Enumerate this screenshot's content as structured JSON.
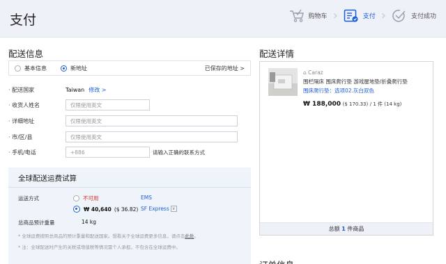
{
  "header": {
    "title": "支付",
    "steps": [
      {
        "label": "购物车",
        "icon": "cart-icon"
      },
      {
        "label": "支付",
        "icon": "checklist-icon"
      },
      {
        "label": "支付成功",
        "icon": "check-circle-icon"
      }
    ],
    "active_step": 1
  },
  "shipping": {
    "title": "配送信息",
    "tabs": [
      {
        "label": "基本信息",
        "selected": false
      },
      {
        "label": "新地址",
        "selected": true
      }
    ],
    "saved_addresses": "已保存的地址 >",
    "fields": {
      "country_label": "配送国家",
      "country_value": "Taiwan",
      "country_edit": "修改 >",
      "name_label": "收货人姓名",
      "name_placeholder": "仅限使用英文",
      "address_label": "详细地址",
      "address_placeholder": "仅限使用英文",
      "city_label": "市/区/县",
      "city_placeholder": "仅限使用英文",
      "phone_label": "手机/电话",
      "phone_prefix": "+886",
      "phone_hint": "请输入正确的联系方式"
    }
  },
  "shipping_calc": {
    "title": "全球配送运费试算",
    "method_label": "运送方式",
    "options": [
      {
        "price": "不可用",
        "carrier": "EMS",
        "selected": false
      },
      {
        "price": "₩ 40,640",
        "usd": "($ 36.82)",
        "carrier": "SF Express",
        "selected": true
      }
    ],
    "weight_label": "总商品预计重量",
    "weight_value": "14 kg",
    "note1": "* 全球运费按照总商品的预计重量和配送国家。想看关于全球运费更多信息，请点击",
    "note1_link": "此处",
    "note1_end": "。",
    "note2": "* 注：全球配送时产生的关税或增值税等情况需个人承担，不包含在全球运费中。"
  },
  "detail": {
    "title": "配送详情",
    "brand": "Caraz",
    "name": "围栏隔床 围床爬行垫 游戏屋地垫/折叠爬行垫",
    "option": "围床爬行垫：选项02.灰白双色",
    "price": "₩ 188,000",
    "usd": "($ 170.33)",
    "qty": "/ 1 件 (14 kg)",
    "total_prefix": "总额",
    "total_count": "1",
    "total_suffix": "件商品"
  },
  "order_info": {
    "title": "订单信息"
  },
  "colors": {
    "accent": "#1a5cd8",
    "error": "#e0322b",
    "header_bg": "#eef1f7",
    "panel_bg": "#eff4fb"
  }
}
